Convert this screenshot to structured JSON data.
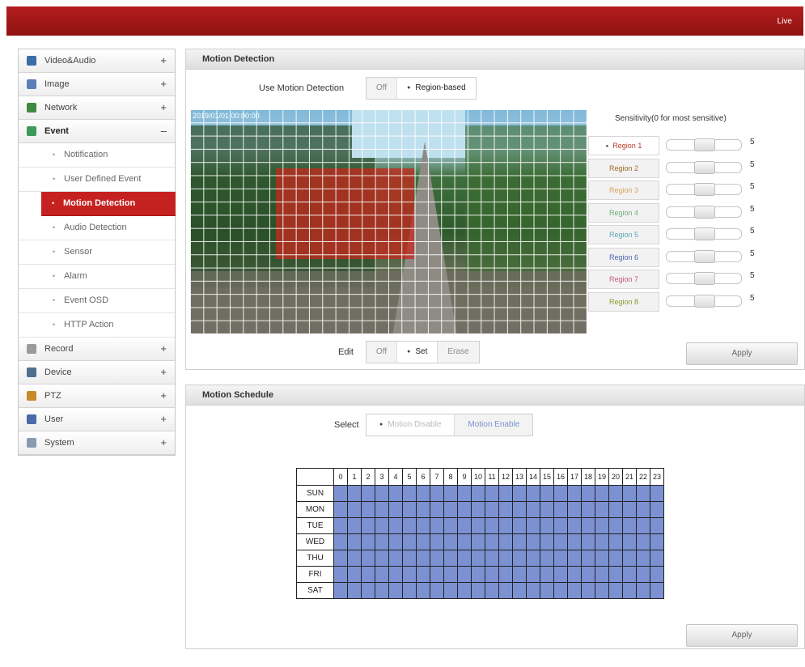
{
  "header": {
    "live_label": "Live"
  },
  "colors": {
    "brand": "#a61818",
    "schedule_cell": "#7b91d2",
    "active_menu": "#c62121"
  },
  "sidebar": {
    "items": [
      {
        "label": "Video&Audio",
        "sign": "+",
        "icon": "video-audio-icon",
        "color": "#3a6ea5"
      },
      {
        "label": "Image",
        "sign": "+",
        "icon": "image-icon",
        "color": "#5b7fb8"
      },
      {
        "label": "Network",
        "sign": "+",
        "icon": "network-icon",
        "color": "#3f8a3f"
      },
      {
        "label": "Event",
        "sign": "–",
        "icon": "event-icon",
        "color": "#3c9a5a"
      }
    ],
    "event_sub": [
      {
        "label": "Notification"
      },
      {
        "label": "User Defined Event"
      },
      {
        "label": "Motion Detection"
      },
      {
        "label": "Audio Detection"
      },
      {
        "label": "Sensor"
      },
      {
        "label": "Alarm"
      },
      {
        "label": "Event OSD"
      },
      {
        "label": "HTTP Action"
      }
    ],
    "items_after": [
      {
        "label": "Record",
        "sign": "+",
        "icon": "record-icon",
        "color": "#9a9a9a"
      },
      {
        "label": "Device",
        "sign": "+",
        "icon": "device-icon",
        "color": "#4f6f8f"
      },
      {
        "label": "PTZ",
        "sign": "+",
        "icon": "ptz-icon",
        "color": "#c8892b"
      },
      {
        "label": "User",
        "sign": "+",
        "icon": "user-icon",
        "color": "#4a6aa8"
      },
      {
        "label": "System",
        "sign": "+",
        "icon": "system-icon",
        "color": "#8a9ab0"
      }
    ]
  },
  "motion": {
    "title": "Motion Detection",
    "use_label": "Use Motion Detection",
    "use_options": [
      "Off",
      "Region-based"
    ],
    "use_selected": 1,
    "video_stamp": "2019/01/01 00:00:00",
    "sensitivity_title": "Sensitivity(0 for most sensitive)",
    "regions": [
      {
        "label": "Region 1",
        "color": "#c0392b",
        "value": "5",
        "level": 0.5
      },
      {
        "label": "Region 2",
        "color": "#9c6b2a",
        "value": "5",
        "level": 0.5
      },
      {
        "label": "Region 3",
        "color": "#d9a35a",
        "value": "5",
        "level": 0.5
      },
      {
        "label": "Region 4",
        "color": "#6fae7a",
        "value": "5",
        "level": 0.5
      },
      {
        "label": "Region 5",
        "color": "#5aa8b8",
        "value": "5",
        "level": 0.5
      },
      {
        "label": "Region 6",
        "color": "#4a64b0",
        "value": "5",
        "level": 0.5
      },
      {
        "label": "Region 7",
        "color": "#c25a7a",
        "value": "5",
        "level": 0.5
      },
      {
        "label": "Region 8",
        "color": "#8a9a30",
        "value": "5",
        "level": 0.5
      }
    ],
    "edit_label": "Edit",
    "edit_options": [
      "Off",
      "Set",
      "Erase"
    ],
    "edit_selected": 1,
    "apply_label": "Apply"
  },
  "schedule": {
    "title": "Motion Schedule",
    "select_label": "Select",
    "select_options": [
      "Motion Disable",
      "Motion Enable"
    ],
    "select_selected": 0,
    "hours": [
      "0",
      "1",
      "2",
      "3",
      "4",
      "5",
      "6",
      "7",
      "8",
      "9",
      "10",
      "11",
      "12",
      "13",
      "14",
      "15",
      "16",
      "17",
      "18",
      "19",
      "20",
      "21",
      "22",
      "23"
    ],
    "days": [
      "SUN",
      "MON",
      "TUE",
      "WED",
      "THU",
      "FRI",
      "SAT"
    ],
    "apply_label": "Apply"
  }
}
